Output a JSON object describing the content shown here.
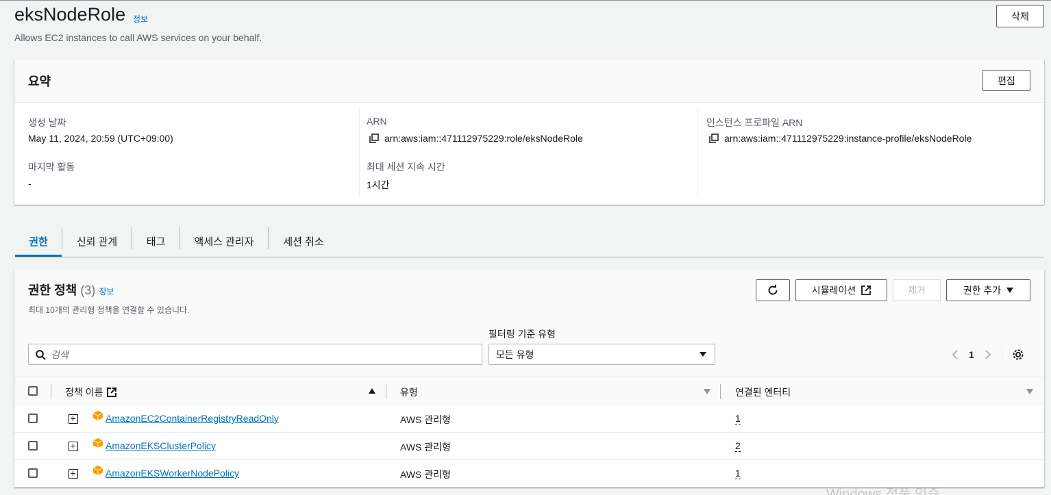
{
  "role": {
    "name": "eksNodeRole",
    "info_label": "정보",
    "description": "Allows EC2 instances to call AWS services on your behalf.",
    "delete_label": "삭제"
  },
  "summary": {
    "title": "요약",
    "edit_label": "편집",
    "created_label": "생성 날짜",
    "created_value": "May 11, 2024, 20:59 (UTC+09:00)",
    "last_activity_label": "마지막 활동",
    "last_activity_value": "-",
    "arn_label": "ARN",
    "arn_value": "arn:aws:iam::471112975229:role/eksNodeRole",
    "max_session_label": "최대 세션 지속 시간",
    "max_session_value": "1시간",
    "instance_profile_label": "인스턴스 프로파일 ARN",
    "instance_profile_value": "arn:aws:iam::471112975229:instance-profile/eksNodeRole"
  },
  "tabs": [
    {
      "label": "권한",
      "active": true
    },
    {
      "label": "신뢰 관계",
      "active": false
    },
    {
      "label": "태그",
      "active": false
    },
    {
      "label": "액세스 관리자",
      "active": false
    },
    {
      "label": "세션 취소",
      "active": false
    }
  ],
  "permissions": {
    "title": "권한 정책",
    "count": "(3)",
    "info_label": "정보",
    "subtitle": "최대 10개의 관리형 정책을 연결할 수 있습니다.",
    "simulate_label": "시뮬레이션",
    "remove_label": "제거",
    "add_label": "권한 추가",
    "filter_label": "필터링 기준 유형",
    "search_placeholder": "검색",
    "filter_value": "모든 유형",
    "page": "1",
    "columns": {
      "name": "정책 이름",
      "type": "유형",
      "entities": "연결된 엔터티"
    },
    "rows": [
      {
        "name": "AmazonEC2ContainerRegistryReadOnly",
        "type": "AWS 관리형",
        "entities": "1"
      },
      {
        "name": "AmazonEKSClusterPolicy",
        "type": "AWS 관리형",
        "entities": "2"
      },
      {
        "name": "AmazonEKSWorkerNodePolicy",
        "type": "AWS 관리형",
        "entities": "1"
      }
    ]
  },
  "watermark": "Windows 정품 인증",
  "colors": {
    "link": "#0073bb",
    "policy_icon": "#f90"
  }
}
